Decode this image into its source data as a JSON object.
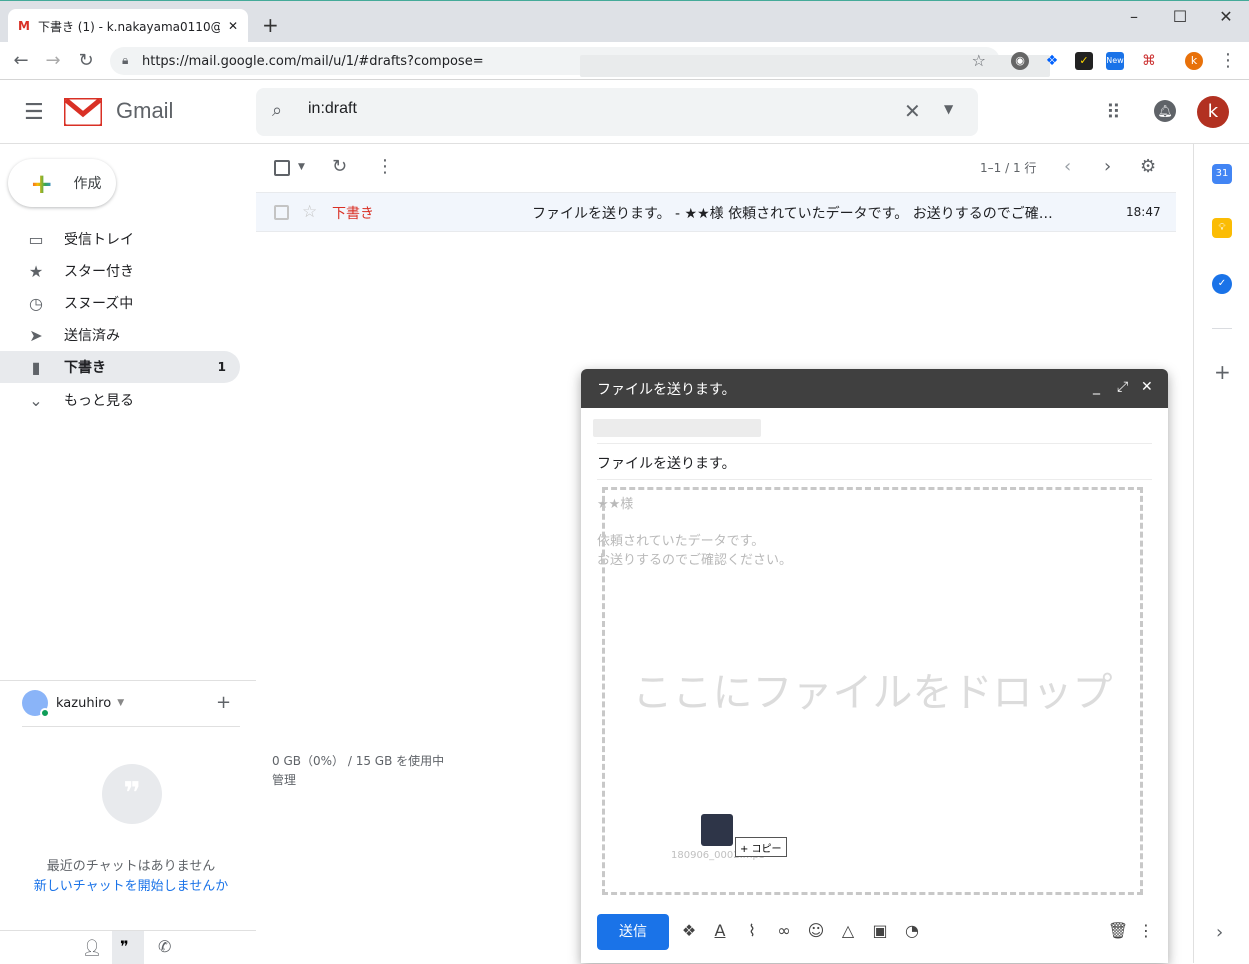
{
  "browser": {
    "tab_title": "下書き (1) - k.nakayama0110@gm",
    "url": "https://mail.google.com/mail/u/1/#drafts?compose=",
    "new_tab_label": "+",
    "profile_initial": "k",
    "ext_new_badge": "New"
  },
  "header": {
    "app_name": "Gmail",
    "search_value": "in:draft",
    "avatar_initial": "k"
  },
  "sidebar": {
    "compose_label": "作成",
    "items": [
      {
        "label": "受信トレイ",
        "icon": "inbox-icon",
        "count": ""
      },
      {
        "label": "スター付き",
        "icon": "star-icon",
        "count": ""
      },
      {
        "label": "スヌーズ中",
        "icon": "clock-icon",
        "count": ""
      },
      {
        "label": "送信済み",
        "icon": "send-icon",
        "count": ""
      },
      {
        "label": "下書き",
        "icon": "draft-icon",
        "count": "1"
      },
      {
        "label": "もっと見る",
        "icon": "chevron-down-icon",
        "count": ""
      }
    ]
  },
  "hangouts": {
    "user_name": "kazuhiro",
    "no_chats": "最近のチャットはありません",
    "start_chat": "新しいチャットを開始しませんか"
  },
  "list": {
    "pager": "1–1 / 1 行",
    "rows": [
      {
        "sender": "下書き",
        "subject": "ファイルを送ります。 - ★★様 依頼されていたデータです。 お送りするのでご確…",
        "time": "18:47"
      }
    ]
  },
  "footer": {
    "storage": "0 GB（0%） / 15 GB を使用中",
    "manage": "管理"
  },
  "right_panel": {
    "calendar_day": "31"
  },
  "compose": {
    "title": "ファイルを送ります。",
    "subject": "ファイルを送ります。",
    "body_greeting": "★★様",
    "body_line1": "依頼されていたデータです。",
    "body_line2": "お送りするのでご確認ください。",
    "drop_text": "ここにファイルをドロップ",
    "drag_filename": "180906_0002.mp3",
    "copy_tip": "+ コピー",
    "send_label": "送信"
  },
  "colors": {
    "accent": "#1a73e8",
    "draft_red": "#d93025",
    "compose_header": "#404040"
  }
}
